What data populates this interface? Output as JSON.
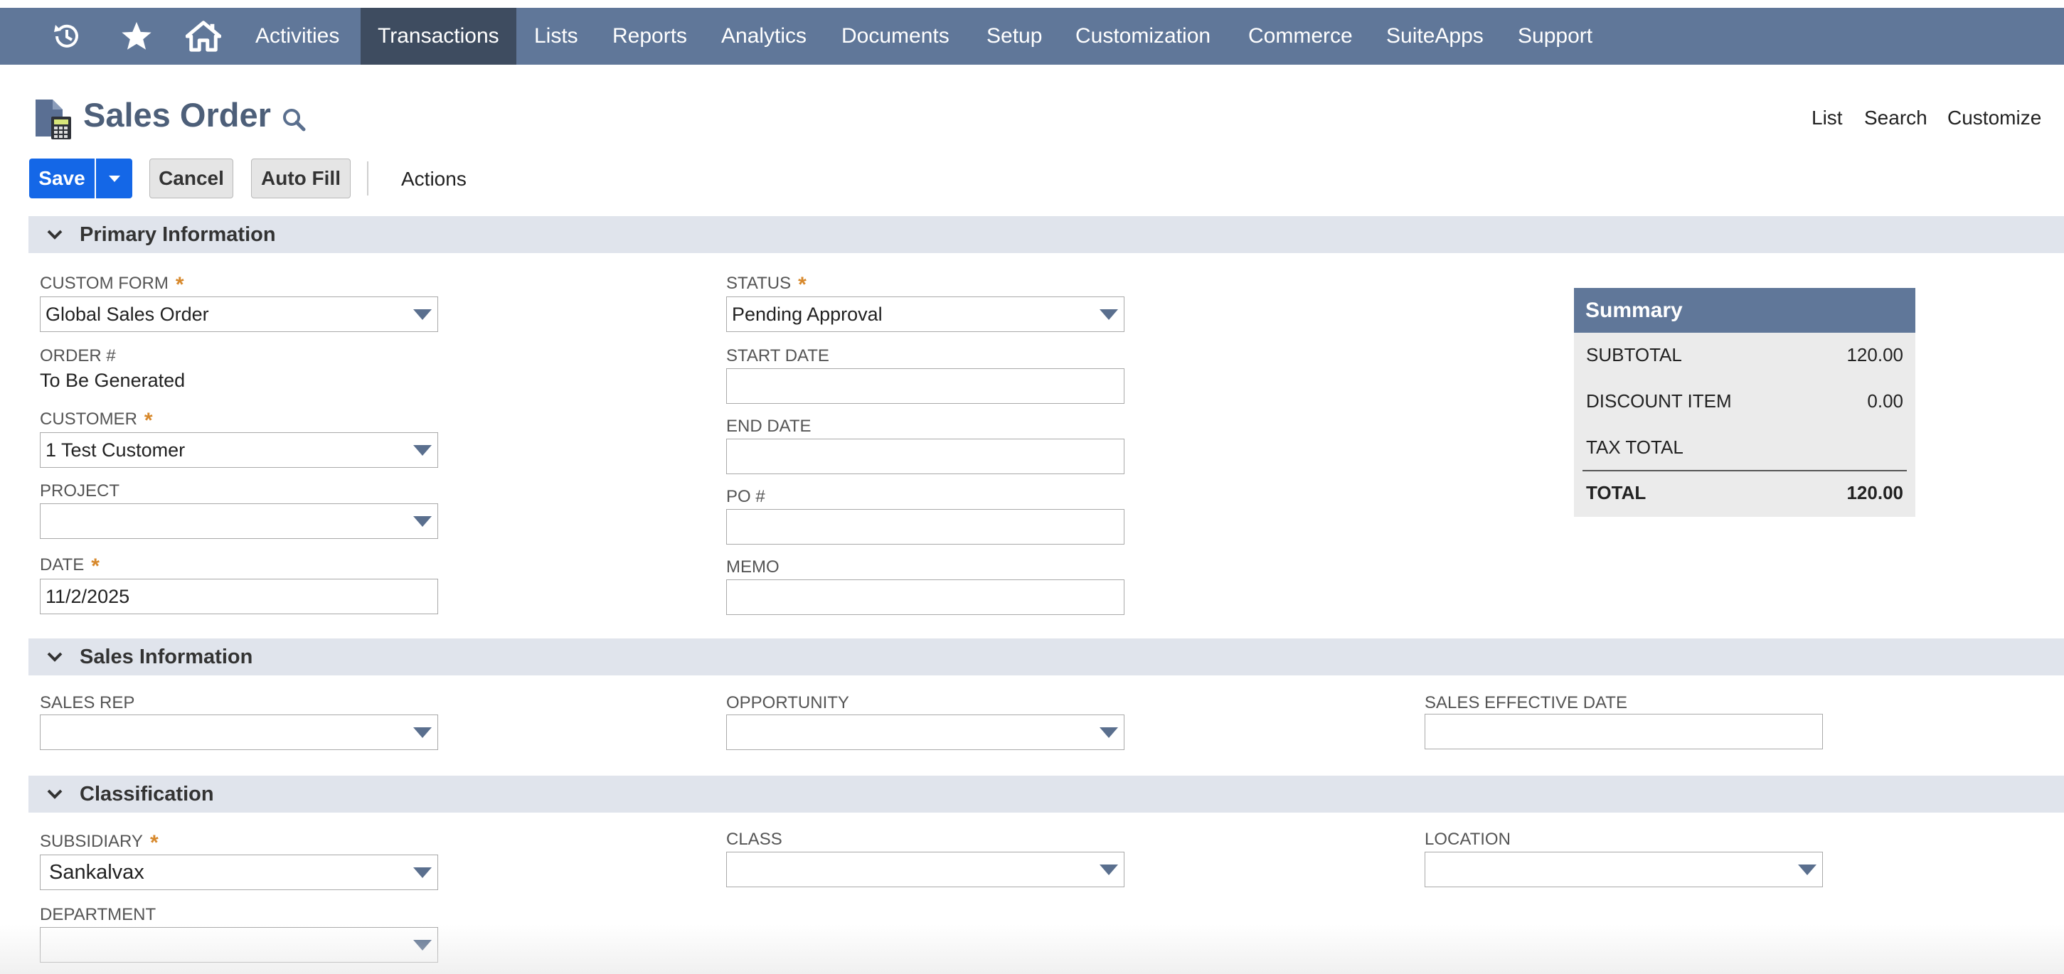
{
  "nav": {
    "items": [
      {
        "label": "Activities"
      },
      {
        "label": "Transactions",
        "active": true
      },
      {
        "label": "Lists"
      },
      {
        "label": "Reports"
      },
      {
        "label": "Analytics"
      },
      {
        "label": "Documents"
      },
      {
        "label": "Setup"
      },
      {
        "label": "Customization"
      },
      {
        "label": "Commerce"
      },
      {
        "label": "SuiteApps"
      },
      {
        "label": "Support"
      }
    ],
    "icons": [
      "recent-history-icon",
      "star-icon",
      "home-icon"
    ]
  },
  "header": {
    "title": "Sales Order",
    "links": {
      "list": "List",
      "search": "Search",
      "customize": "Customize"
    }
  },
  "toolbar": {
    "save": "Save",
    "cancel": "Cancel",
    "auto_fill": "Auto Fill",
    "actions": "Actions"
  },
  "sections": {
    "primary": "Primary Information",
    "sales": "Sales Information",
    "classification": "Classification"
  },
  "fields": {
    "custom_form": {
      "label": "CUSTOM FORM",
      "value": "Global Sales Order"
    },
    "order_num": {
      "label": "ORDER #",
      "value": "To Be Generated"
    },
    "customer": {
      "label": "CUSTOMER",
      "value": "1 Test Customer"
    },
    "project": {
      "label": "PROJECT",
      "value": ""
    },
    "date": {
      "label": "DATE",
      "value": "11/2/2025"
    },
    "status": {
      "label": "STATUS",
      "value": "Pending Approval"
    },
    "start_date": {
      "label": "START DATE",
      "value": ""
    },
    "end_date": {
      "label": "END DATE",
      "value": ""
    },
    "po_num": {
      "label": "PO #",
      "value": ""
    },
    "memo": {
      "label": "MEMO",
      "value": ""
    },
    "sales_rep": {
      "label": "SALES REP",
      "value": ""
    },
    "opportunity": {
      "label": "OPPORTUNITY",
      "value": ""
    },
    "sales_effective_date": {
      "label": "SALES EFFECTIVE DATE",
      "value": ""
    },
    "subsidiary": {
      "label": "SUBSIDIARY",
      "value": "Sankalvax"
    },
    "class": {
      "label": "CLASS",
      "value": ""
    },
    "location": {
      "label": "LOCATION",
      "value": ""
    },
    "department": {
      "label": "DEPARTMENT",
      "value": ""
    }
  },
  "summary": {
    "title": "Summary",
    "rows": [
      {
        "label": "SUBTOTAL",
        "value": "120.00"
      },
      {
        "label": "DISCOUNT ITEM",
        "value": "0.00"
      },
      {
        "label": "TAX TOTAL",
        "value": ""
      },
      {
        "label": "TOTAL",
        "value": "120.00"
      }
    ]
  },
  "colors": {
    "nav_bg": "#607799",
    "nav_active": "#3e4c60",
    "primary_button": "#1467e7",
    "section_bar": "#e0e4ec",
    "required_star": "#d7882b"
  }
}
